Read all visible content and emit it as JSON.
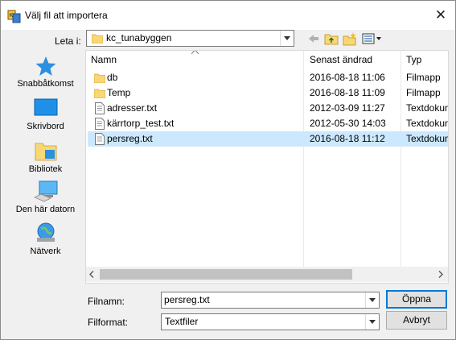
{
  "dialog": {
    "title": "Välj fil att importera",
    "close_glyph": "✕"
  },
  "lookin": {
    "label": "Leta i:",
    "value": "kc_tunabyggen"
  },
  "places": [
    {
      "label": "Snabbåtkomst",
      "icon": "star-icon"
    },
    {
      "label": "Skrivbord",
      "icon": "desktop-icon"
    },
    {
      "label": "Bibliotek",
      "icon": "library-icon"
    },
    {
      "label": "Den här datorn",
      "icon": "computer-icon"
    },
    {
      "label": "Nätverk",
      "icon": "network-icon"
    }
  ],
  "columns": {
    "name": "Namn",
    "modified": "Senast ändrad",
    "type": "Typ"
  },
  "files": [
    {
      "name": "db",
      "modified": "2016-08-18 11:06",
      "type": "Filmapp",
      "kind": "folder"
    },
    {
      "name": "Temp",
      "modified": "2016-08-18 11:09",
      "type": "Filmapp",
      "kind": "folder"
    },
    {
      "name": "adresser.txt",
      "modified": "2012-03-09 11:27",
      "type": "Textdokument",
      "kind": "text"
    },
    {
      "name": "kärrtorp_test.txt",
      "modified": "2012-05-30 14:03",
      "type": "Textdokument",
      "kind": "text"
    },
    {
      "name": "persreg.txt",
      "modified": "2016-08-18 11:12",
      "type": "Textdokument",
      "kind": "text",
      "selected": true
    }
  ],
  "filename": {
    "label": "Filnamn:",
    "value": "persreg.txt"
  },
  "filetype": {
    "label": "Filformat:",
    "value": "Textfiler"
  },
  "buttons": {
    "open": "Öppna",
    "cancel": "Avbryt"
  },
  "colors": {
    "selection": "#cce8ff",
    "accent": "#0078d7",
    "folder": "#f8d775"
  }
}
